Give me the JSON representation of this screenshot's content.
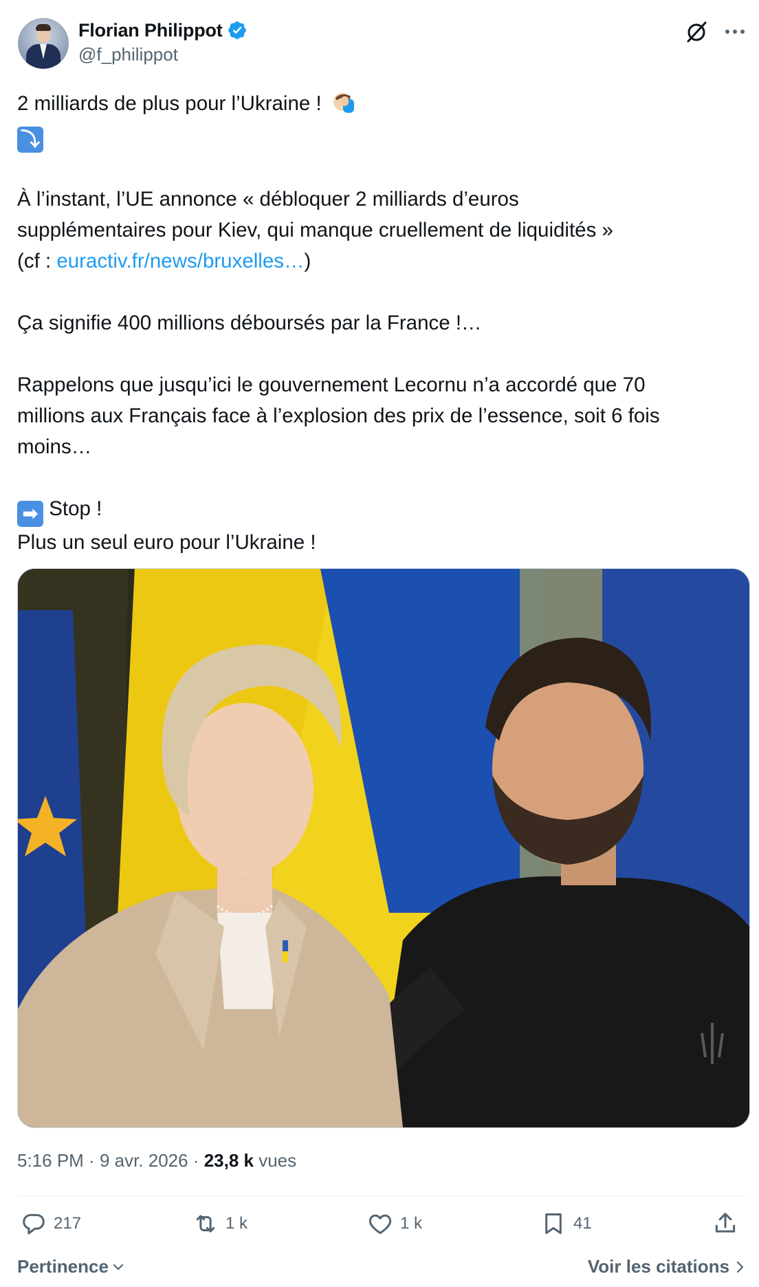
{
  "author": {
    "name": "Florian Philippot",
    "handle": "@f_philippot"
  },
  "icons": {
    "verified": "verified-badge-icon",
    "grok": "grok-icon",
    "more": "more-icon",
    "reply": "reply-icon",
    "retweet": "retweet-icon",
    "like": "like-icon",
    "bookmark": "bookmark-icon",
    "share": "share-icon"
  },
  "tweet": {
    "line1": "2 milliards de plus pour l’Ukraine !",
    "down_arrow_emoji": "⤵",
    "para1_a": "À l’instant, l’UE annonce « débloquer 2 milliards d’euros",
    "para1_b": "supplémentaires pour Kiev, qui manque cruellement de liquidités »",
    "para1_c_prefix": "(cf : ",
    "para1_link": "euractiv.fr/news/bruxelles…",
    "para1_c_suffix": ")",
    "para2": "Ça signifie 400 millions déboursés par la France !…",
    "para3_a": "Rappelons que jusqu’ici le gouvernement Lecornu n’a accordé que 70",
    "para3_b": "millions aux Français face à l’explosion des prix de l’essence, soit 6 fois",
    "para3_c": "moins…",
    "right_arrow_emoji": "➡",
    "stop": "Stop !",
    "last": "Plus un seul euro pour l’Ukraine !"
  },
  "meta": {
    "time": "5:16 PM",
    "sep1": " · ",
    "date": "9 avr. 2026",
    "sep2": " · ",
    "views_count": "23,8 k",
    "views_label": " vues"
  },
  "actions": {
    "replies": "217",
    "reposts": "1 k",
    "likes": "1 k",
    "bookmarks": "41"
  },
  "footer": {
    "sort_label": "Pertinence",
    "quotes_label": "Voir les citations"
  },
  "colors": {
    "link": "#1d9bf0",
    "secondary_text": "#536471",
    "primary_text": "#0f1419",
    "verified": "#1d9bf0"
  }
}
